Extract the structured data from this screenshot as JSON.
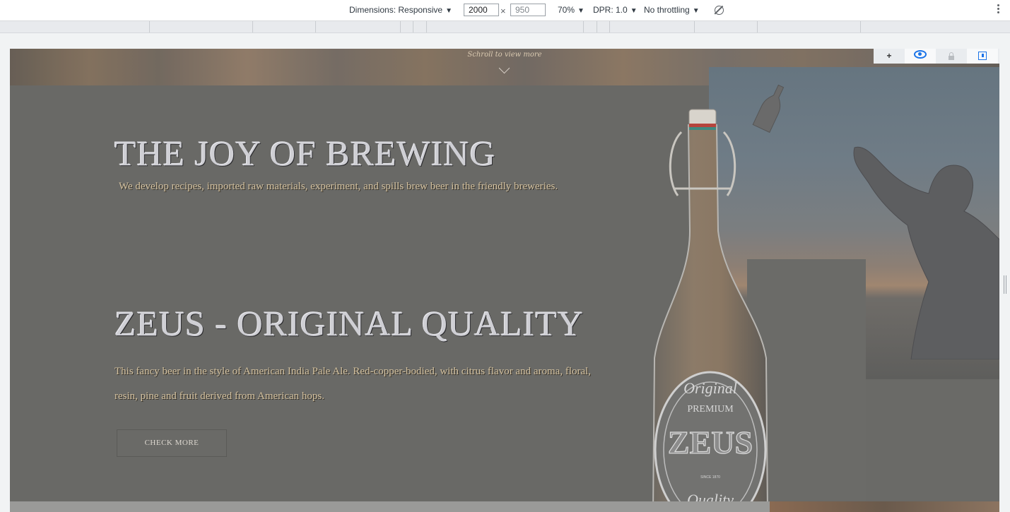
{
  "devtools": {
    "dimensions_label": "Dimensions: Responsive",
    "width_value": "2000",
    "height_value": "950",
    "times": "×",
    "zoom": "70%",
    "dpr": "DPR: 1.0",
    "throttling": "No throttling"
  },
  "page": {
    "scroll_hint": "Schroll to view more",
    "heading_1": "THE JOY OF BREWING",
    "subheading_1": "We develop recipes, imported raw materials, experiment, and spills brew beer in the friendly breweries.",
    "heading_2": "ZEUS - ORIGINAL QUALITY",
    "description": "This fancy beer in the style of American India Pale Ale. Red-copper-bodied, with citrus flavor and aroma, floral, resin, pine and fruit derived from American hops.",
    "cta_label": "CHECK MORE"
  },
  "bottle_label": {
    "top": "Original",
    "middle": "PREMIUM",
    "brand": "ZEUS",
    "since": "SINCE 1870",
    "bottom": "Quality"
  },
  "overlay_toolbar": {
    "add": "+"
  },
  "colors": {
    "page_bg": "#696966",
    "heading": "#cfcfd4",
    "body_text": "#d4c2a0",
    "accent_blue": "#1a73e8"
  }
}
